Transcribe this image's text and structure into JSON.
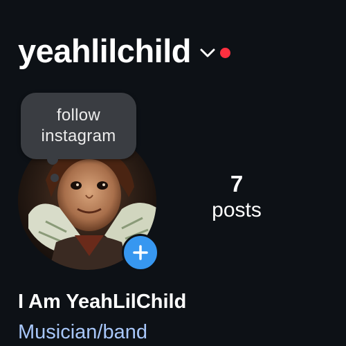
{
  "header": {
    "username": "yeahlilchild",
    "dropdown_icon": "chevron-down-icon",
    "notification_dot_color": "#ff3040"
  },
  "tooltip": {
    "line1": "follow",
    "line2": "instagram"
  },
  "avatar": {
    "add_icon": "plus-icon",
    "add_button_color": "#3797f0"
  },
  "stats": {
    "posts_count": "7",
    "posts_label": "posts"
  },
  "bio": {
    "display_name": "I Am YeahLilChild",
    "category": "Musician/band",
    "category_color": "#a8c7fa"
  }
}
